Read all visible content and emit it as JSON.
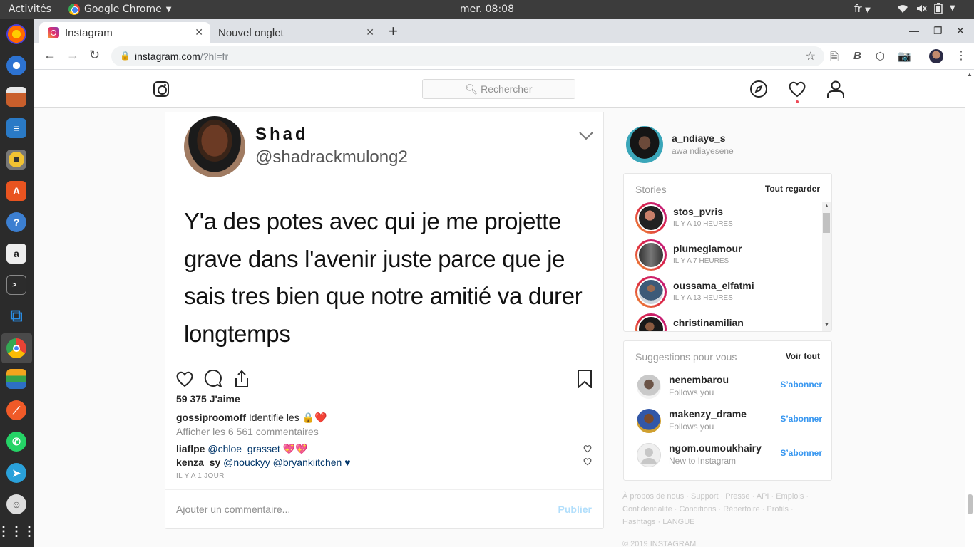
{
  "system": {
    "activities": "Activités",
    "app_name": "Google Chrome",
    "clock": "mer. 08:08",
    "language": "fr"
  },
  "browser": {
    "tabs": [
      {
        "title": "Instagram"
      },
      {
        "title": "Nouvel onglet"
      }
    ],
    "url_host": "instagram.com",
    "url_path": "/?hl=fr"
  },
  "ig": {
    "search_placeholder": "Rechercher",
    "post": {
      "tweet_name": "Shad",
      "tweet_handle": "@shadrackmulong2",
      "tweet_text": "Y'a des potes avec qui je me projette grave dans l'avenir juste parce que je sais tres bien que notre amitié va durer longtemps",
      "likes": "59 375 J'aime",
      "caption_user": "gossiproomoff",
      "caption_text": " Identifie les 🔒❤️",
      "view_comments": "Afficher les 6 561 commentaires",
      "comments": [
        {
          "user": "liaflpe",
          "text": " @chloe_grasset 💖💖"
        },
        {
          "user": "kenza_sy",
          "text": " @nouckyy @bryankiitchen ♥"
        }
      ],
      "time_ago": "IL Y A 1 JOUR",
      "comment_placeholder": "Ajouter un commentaire...",
      "publish": "Publier"
    },
    "me": {
      "username": "a_ndiaye_s",
      "fullname": "awa ndiayesene"
    },
    "stories": {
      "title": "Stories",
      "link": "Tout regarder",
      "items": [
        {
          "name": "stos_pvris",
          "time": "IL Y A 10 HEURES"
        },
        {
          "name": "plumeglamour",
          "time": "IL Y A 7 HEURES"
        },
        {
          "name": "oussama_elfatmi",
          "time": "IL Y A 13 HEURES"
        },
        {
          "name": "christinamilian",
          "time": ""
        }
      ]
    },
    "suggestions": {
      "title": "Suggestions pour vous",
      "link": "Voir tout",
      "items": [
        {
          "name": "nenembarou",
          "sub": "Follows you",
          "action": "S’abonner"
        },
        {
          "name": "makenzy_drame",
          "sub": "Follows you",
          "action": "S’abonner"
        },
        {
          "name": "ngom.oumoukhairy",
          "sub": "New to Instagram",
          "action": "S’abonner"
        }
      ]
    },
    "footer": {
      "line1": "À propos de nous · Support · Presse · API · Emplois ·",
      "line2": "Confidentialité · Conditions · Répertoire · Profils ·",
      "line3": "Hashtags · LANGUE",
      "copyright": "© 2019 INSTAGRAM"
    }
  }
}
